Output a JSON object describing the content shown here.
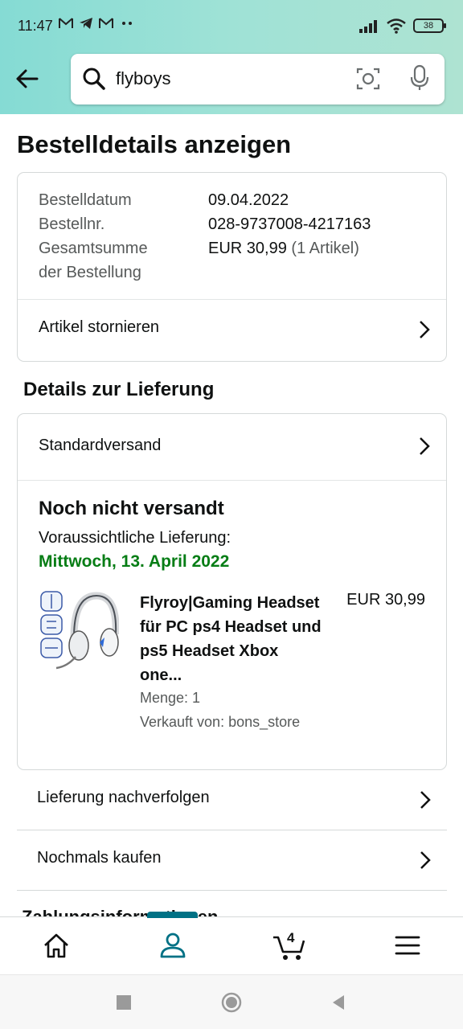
{
  "status_bar": {
    "time": "11:47",
    "notification_icons": [
      "gmail-icon",
      "telegram-icon",
      "gmail-icon",
      "more-dots-icon"
    ],
    "battery": "38"
  },
  "header": {
    "search_value": "flyboys"
  },
  "page": {
    "title": "Bestelldetails anzeigen"
  },
  "order_summary": {
    "date_label": "Bestelldatum",
    "date_value": "09.04.2022",
    "number_label": "Bestellnr.",
    "number_value": "028-9737008-4217163",
    "total_label_line1": "Gesamtsumme",
    "total_label_line2": "der Bestellung",
    "total_value": "EUR 30,99",
    "total_items": "(1 Artikel)",
    "cancel_link": "Artikel stornieren"
  },
  "delivery": {
    "heading": "Details zur Lieferung",
    "shipping_method": "Standardversand",
    "status": "Noch nicht versandt",
    "eta_label": "Voraussichtliche Lieferung:",
    "eta_date": "Mittwoch, 13. April 2022",
    "product": {
      "name": "Flyroy|Gaming Headset für PC ps4 Headset und ps5 Headset Xbox one...",
      "price": "EUR 30,99",
      "quantity": "Menge: 1",
      "seller": "Verkauft von: bons_store"
    }
  },
  "actions": {
    "track": "Lieferung nachverfolgen",
    "buy_again": "Nochmals kaufen",
    "next_section_peek": "Zahlungsinformationen"
  },
  "bottom_nav": {
    "items": [
      "home-icon",
      "account-icon",
      "cart-icon",
      "menu-icon"
    ],
    "active": "account-icon",
    "cart_count": "4",
    "accent_color": "#007185"
  },
  "colors": {
    "delivery_green": "#067d15",
    "header_gradient_start": "#85dbd4",
    "header_gradient_end": "#aee3d2"
  }
}
